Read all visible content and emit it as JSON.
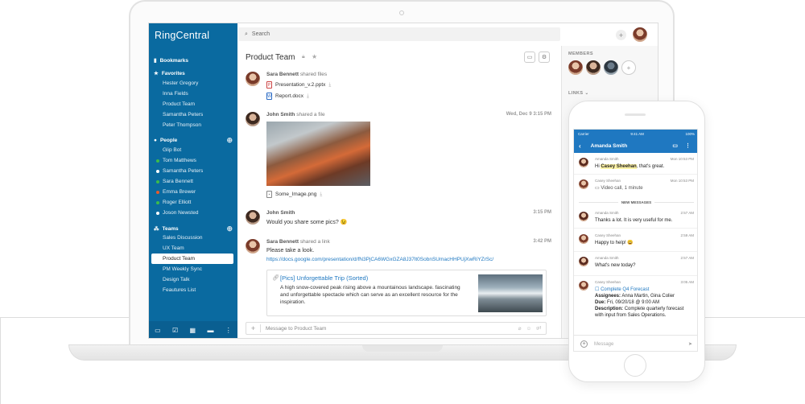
{
  "app": {
    "brand": "RingCentral"
  },
  "sidebar": {
    "bookmarks": "Bookmarks",
    "favorites": {
      "label": "Favorites",
      "items": [
        "Hester Gregory",
        "Inna Fields",
        "Product Team",
        "Samantha Peters",
        "Peter Thompson"
      ]
    },
    "people": {
      "label": "People",
      "items": [
        {
          "name": "Glip Bot",
          "status": "none"
        },
        {
          "name": "Tom Matthews",
          "status": "#3dbb4a"
        },
        {
          "name": "Samantha Peters",
          "status": "#ffffff"
        },
        {
          "name": "Sara Bennett",
          "status": "#3dbb4a"
        },
        {
          "name": "Emma Brewer",
          "status": "#e85a2a"
        },
        {
          "name": "Roger Elliott",
          "status": "#3dbb4a"
        },
        {
          "name": "Joson Newsted",
          "status": "#ffffff"
        }
      ]
    },
    "teams": {
      "label": "Teams",
      "items": [
        "Sales Discussion",
        "UX Team",
        "Product Team",
        "PM Weekly Sync",
        "Design Talk",
        "Feautures List"
      ],
      "selected": "Product Team"
    }
  },
  "header": {
    "search_placeholder": "Search"
  },
  "conversation": {
    "title": "Product Team",
    "messages": [
      {
        "author": "Sara Bennett",
        "action": "shared files",
        "files": [
          "Presentation_v.2.pptx",
          "Report.docx"
        ]
      },
      {
        "author": "John Smith",
        "action": "shared a file",
        "time": "Wed, Dec 9  3:15 PM",
        "file": "Some_Image.png"
      },
      {
        "author": "John Smith",
        "time": "3:15 PM",
        "text": "Would you share some pics?",
        "emoji": "😉"
      },
      {
        "author": "Sara Bennett",
        "action": "shared a link",
        "time": "3:42 PM",
        "text": "Please take a look.",
        "url": "https://docs.google.com/presentation/d/fN3PjCA6WGxGZA8J37lt0SobnSUmacHHPUjXwRiYZrSc/",
        "card": {
          "title": "[Pics] Unforgettable Trip (Sorted)",
          "desc": "A high snow-covered peak rising above a mountainous landscape. fascinating and unforgettable spectacle which can serve as an excellent resource for the inspiration."
        }
      }
    ],
    "composer_placeholder": "Message to Product Team"
  },
  "right_panel": {
    "members_label": "MEMBERS",
    "links_label": "LINKS"
  },
  "phone": {
    "status": {
      "carrier": "Carrier",
      "time": "9:41 AM",
      "battery": "100%"
    },
    "title": "Amanda Smith",
    "messages": [
      {
        "name": "Amanda Smith",
        "time": "Mon 10:53 PM",
        "pre": "Hi ",
        "highlight": "Casey Sheehan",
        "post": ", that's great."
      },
      {
        "name": "Casey Sheehan",
        "time": "Mon 10:53 PM",
        "text": "Video call, 1 minute"
      },
      {
        "name": "Amanda Smith",
        "time": "2:57 AM",
        "text": "Thanks a lot. It is very useful for me."
      },
      {
        "name": "Casey Sheehan",
        "time": "2:59 AM",
        "text": "Happy to help! 😀"
      },
      {
        "name": "Amanda Smith",
        "time": "2:57 AM",
        "text": "What's new today?"
      },
      {
        "name": "Casey Sheehan",
        "time": "3:05 AM",
        "task": "Complete Q4 Forecast",
        "assignees_label": "Assignees:",
        "assignees": "Anna Martin, Gina Colier",
        "due_label": "Due:",
        "due": "Fri, 09/20/18 @ 9:00 AM",
        "desc_label": "Description:",
        "desc": "Complete quarterly forecast with input from Sales Operations."
      }
    ],
    "new_messages": "NEW MESSAGES",
    "composer_placeholder": "Message"
  },
  "colors": {
    "sidebar": "#0a6aa0",
    "accent": "#1f78c1",
    "online": "#3dbb4a"
  }
}
